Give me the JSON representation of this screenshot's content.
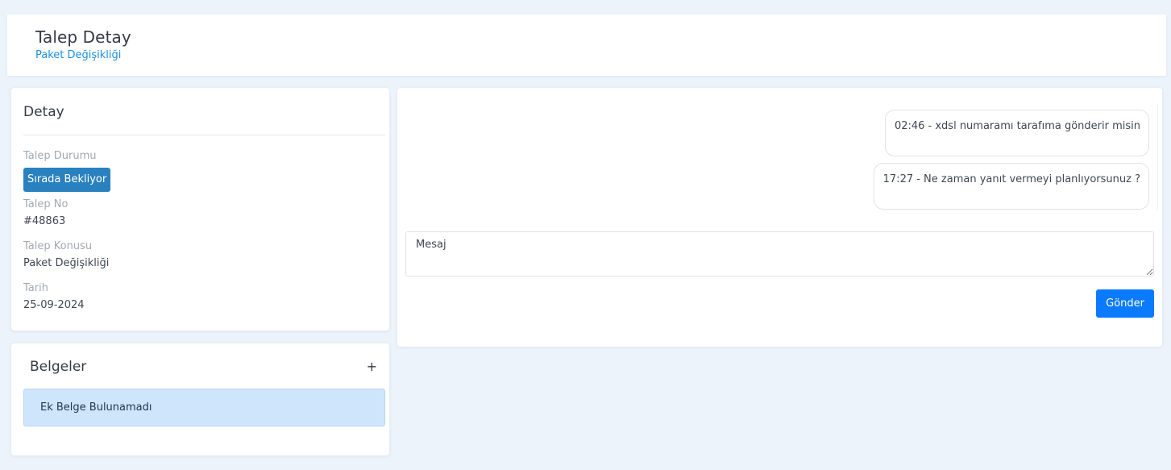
{
  "header": {
    "title": "Talep Detay",
    "subtitle": "Paket Değişikliği"
  },
  "detail": {
    "title": "Detay",
    "fields": [
      {
        "label": "Talep Durumu",
        "badge": "Sırada Bekliyor"
      },
      {
        "label": "Talep No",
        "value": "#48863"
      },
      {
        "label": "Talep Konusu",
        "value": "Paket Değişikliği"
      },
      {
        "label": "Tarih",
        "value": "25-09-2024"
      }
    ]
  },
  "documents": {
    "title": "Belgeler",
    "add_label": "+",
    "empty_text": "Ek Belge Bulunamadı"
  },
  "chat": {
    "messages": [
      {
        "text": "02:46 - xdsl numaramı tarafıma gönderir misin"
      },
      {
        "text": "17:27 - Ne zaman yanıt vermeyi planlıyorsunuz ?"
      }
    ],
    "input_placeholder": "Mesaj",
    "input_value": "",
    "send_label": "Gönder"
  },
  "colors": {
    "accent": "#0a7bff",
    "badge": "#2a81bf",
    "link": "#1a8fe3",
    "alert_bg": "#cfe5fb"
  }
}
